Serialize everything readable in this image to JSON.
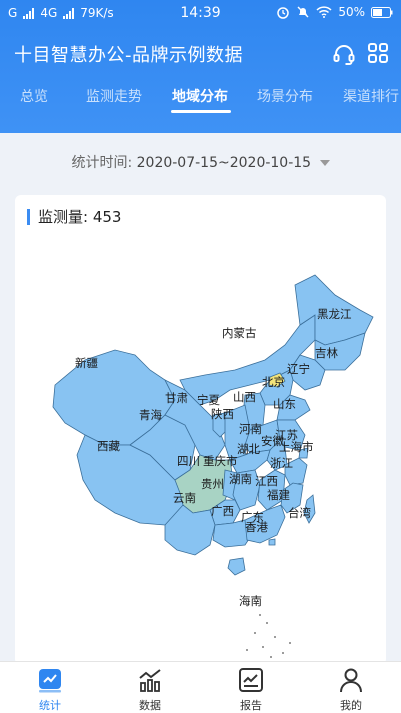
{
  "status_bar": {
    "network": "G",
    "network_type": "4G",
    "speed": "79K/s",
    "time": "14:39",
    "battery": "50%"
  },
  "header": {
    "title": "十目智慧办公-品牌示例数据"
  },
  "tabs": [
    {
      "label": "总览"
    },
    {
      "label": "监测走势"
    },
    {
      "label": "地域分布"
    },
    {
      "label": "场景分布"
    },
    {
      "label": "渠道排行"
    }
  ],
  "filter": {
    "label": "统计时间:",
    "value": "2020-07-15~2020-10-15"
  },
  "summary": {
    "label": "监测量:",
    "value": "453"
  },
  "map": {
    "colors": {
      "base": "#88c3f2",
      "border": "#3b6f9a",
      "sichuan": "#a8d3c4",
      "beijing": "#f2e37a"
    },
    "regions": [
      {
        "name": "黑龙江"
      },
      {
        "name": "吉林"
      },
      {
        "name": "辽宁"
      },
      {
        "name": "内蒙古"
      },
      {
        "name": "北京"
      },
      {
        "name": "新疆"
      },
      {
        "name": "甘肃"
      },
      {
        "name": "宁夏"
      },
      {
        "name": "山西"
      },
      {
        "name": "山东"
      },
      {
        "name": "青海"
      },
      {
        "name": "陕西"
      },
      {
        "name": "河南"
      },
      {
        "name": "江苏"
      },
      {
        "name": "西藏"
      },
      {
        "name": "四川"
      },
      {
        "name": "重庆市"
      },
      {
        "name": "湖北"
      },
      {
        "name": "安徽"
      },
      {
        "name": "上海市"
      },
      {
        "name": "浙江"
      },
      {
        "name": "贵州"
      },
      {
        "name": "湖南"
      },
      {
        "name": "江西"
      },
      {
        "name": "福建"
      },
      {
        "name": "云南"
      },
      {
        "name": "广西"
      },
      {
        "name": "广东"
      },
      {
        "name": "台湾"
      },
      {
        "name": "香港"
      },
      {
        "name": "海南"
      }
    ]
  },
  "bottom_nav": [
    {
      "label": "统计",
      "icon": "stats-icon",
      "active": true
    },
    {
      "label": "数据",
      "icon": "bar-chart-icon",
      "active": false
    },
    {
      "label": "报告",
      "icon": "report-icon",
      "active": false
    },
    {
      "label": "我的",
      "icon": "user-icon",
      "active": false
    }
  ]
}
